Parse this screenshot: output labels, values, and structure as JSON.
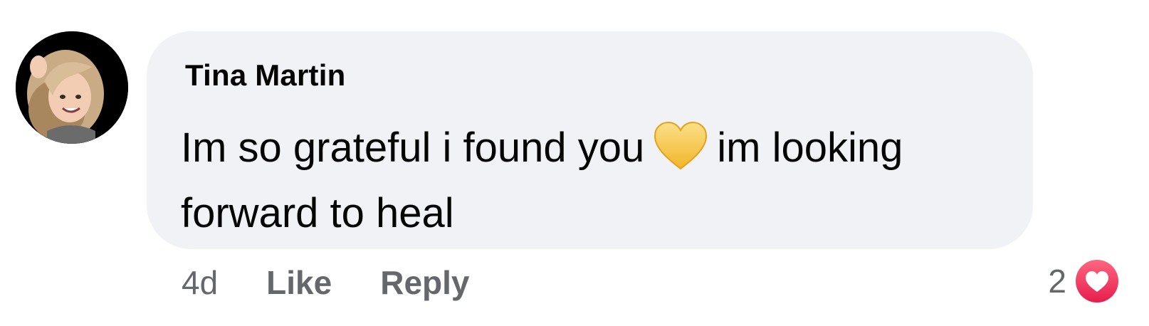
{
  "comment": {
    "author": "Tina Martin",
    "text_before_emoji": "Im so grateful i found you",
    "emoji": "yellow-heart",
    "text_after_emoji": "im looking forward to heal",
    "time": "4d",
    "like_label": "Like",
    "reply_label": "Reply",
    "reaction_count": "2",
    "reaction_type": "love"
  },
  "colors": {
    "bubble_bg": "#f0f2f5",
    "text": "#050505",
    "meta_text": "#65676b",
    "love_reaction": "#f02849",
    "yellow_heart": "#f7c948"
  }
}
